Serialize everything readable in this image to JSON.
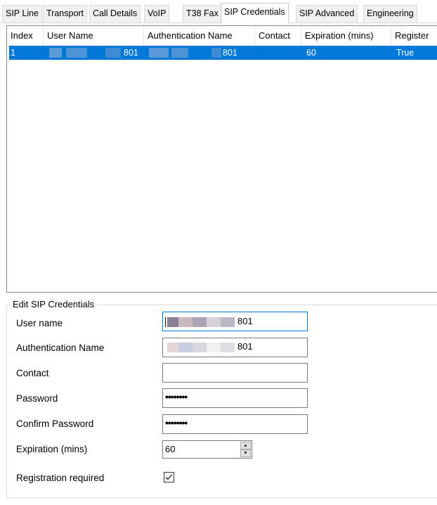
{
  "tabs": [
    {
      "label": "SIP Line"
    },
    {
      "label": "Transport"
    },
    {
      "label": "Call Details"
    },
    {
      "label": "VoIP"
    },
    {
      "label": "T38 Fax"
    },
    {
      "label": "SIP Credentials"
    },
    {
      "label": "SIP Advanced"
    },
    {
      "label": "Engineering"
    }
  ],
  "active_tab": "SIP Credentials",
  "grid": {
    "columns": [
      "Index",
      "User Name",
      "Authentication Name",
      "Contact",
      "Expiration (mins)",
      "Register"
    ],
    "rows": [
      {
        "index": "1",
        "user_name": "801",
        "auth_name": "801",
        "contact": "",
        "expiration": "60",
        "register": "True"
      }
    ]
  },
  "edit": {
    "title": "Edit SIP Credentials",
    "user_name_label": "User name",
    "user_name_value": "801",
    "auth_name_label": "Authentication Name",
    "auth_name_value": "801",
    "contact_label": "Contact",
    "contact_value": "",
    "password_label": "Password",
    "password_value": "••••••••",
    "confirm_label": "Confirm Password",
    "confirm_value": "••••••••",
    "expiration_label": "Expiration (mins)",
    "expiration_value": "60",
    "registration_label": "Registration required",
    "registration_checked": true
  },
  "colors": {
    "selection": "#0078d7",
    "focus_border": "#0078d7"
  }
}
